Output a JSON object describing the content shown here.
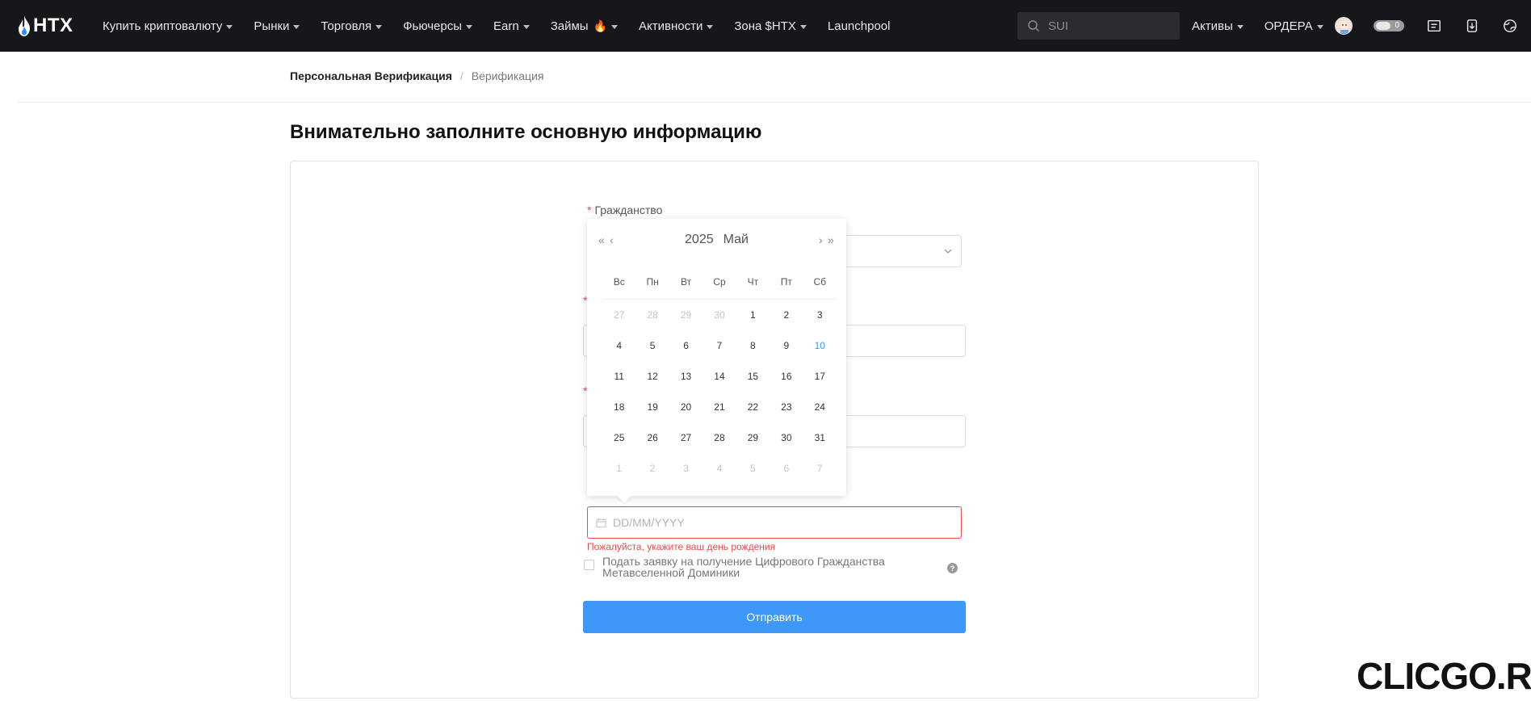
{
  "brand": {
    "name": "HTX"
  },
  "nav": {
    "items": [
      {
        "label": "Купить криптовалюту",
        "caret": true
      },
      {
        "label": "Рынки",
        "caret": true
      },
      {
        "label": "Торговля",
        "caret": true
      },
      {
        "label": "Фьючерсы",
        "caret": true
      },
      {
        "label": "Earn",
        "caret": true
      },
      {
        "label": "Займы",
        "caret": true,
        "badge": "fire-icon"
      },
      {
        "label": "Активности",
        "caret": true
      },
      {
        "label": "Зона $HTX",
        "caret": true
      },
      {
        "label": "Launchpool",
        "caret": false
      }
    ],
    "search_placeholder": "SUI",
    "right_items": [
      {
        "label": "Активы"
      },
      {
        "label": "ОРДЕРА"
      }
    ],
    "toggle_label": "0"
  },
  "breadcrumb": {
    "parent": "Персональная Верификация",
    "separator": "/",
    "current": "Верификация"
  },
  "page": {
    "title": "Внимательно заполните основную информацию"
  },
  "form": {
    "citizenship_label": "Гражданство",
    "required_mark": "*",
    "birthdate_placeholder": "DD/MM/YYYY",
    "birthdate_error": "Пожалуйста, укажите ваш день рождения",
    "dominica_label": "Подать заявку на получение Цифрового Гражданства Метавселенной Доминики",
    "help": "?",
    "submit_label": "Отправить"
  },
  "calendar": {
    "year": "2025",
    "month": "Май",
    "prev_year": "«",
    "prev_month": "‹",
    "next_month": "›",
    "next_year": "»",
    "weekdays": [
      "Вс",
      "Пн",
      "Вт",
      "Ср",
      "Чт",
      "Пт",
      "Сб"
    ],
    "weeks": [
      [
        {
          "d": "27",
          "m": true
        },
        {
          "d": "28",
          "m": true
        },
        {
          "d": "29",
          "m": true
        },
        {
          "d": "30",
          "m": true
        },
        {
          "d": "1"
        },
        {
          "d": "2"
        },
        {
          "d": "3"
        }
      ],
      [
        {
          "d": "4"
        },
        {
          "d": "5"
        },
        {
          "d": "6"
        },
        {
          "d": "7"
        },
        {
          "d": "8"
        },
        {
          "d": "9"
        },
        {
          "d": "10",
          "today": true
        }
      ],
      [
        {
          "d": "11"
        },
        {
          "d": "12"
        },
        {
          "d": "13"
        },
        {
          "d": "14"
        },
        {
          "d": "15"
        },
        {
          "d": "16"
        },
        {
          "d": "17"
        }
      ],
      [
        {
          "d": "18"
        },
        {
          "d": "19"
        },
        {
          "d": "20"
        },
        {
          "d": "21"
        },
        {
          "d": "22"
        },
        {
          "d": "23"
        },
        {
          "d": "24"
        }
      ],
      [
        {
          "d": "25"
        },
        {
          "d": "26"
        },
        {
          "d": "27"
        },
        {
          "d": "28"
        },
        {
          "d": "29"
        },
        {
          "d": "30"
        },
        {
          "d": "31"
        }
      ],
      [
        {
          "d": "1",
          "m": true
        },
        {
          "d": "2",
          "m": true
        },
        {
          "d": "3",
          "m": true
        },
        {
          "d": "4",
          "m": true
        },
        {
          "d": "5",
          "m": true
        },
        {
          "d": "6",
          "m": true
        },
        {
          "d": "7",
          "m": true
        }
      ]
    ]
  },
  "watermark": "CLICGO.RU",
  "colors": {
    "accent": "#3e98f8",
    "error": "#e94b4b",
    "topbar": "#16171b"
  }
}
